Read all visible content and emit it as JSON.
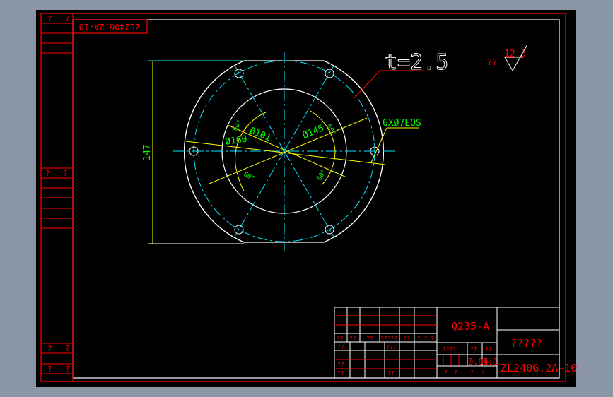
{
  "colors": {
    "background": "#000000",
    "frame": "#8a95a5",
    "border": "#ff0000",
    "geometry": "#ffffff",
    "centerline": "#00e5ff",
    "dimension": "#ffff00",
    "dimension_text": "#00ff00"
  },
  "drawing": {
    "thickness_note": "t=2.5",
    "roughness_prefix": "??",
    "roughness_value": "12.5",
    "hole_callout": "6XØ7EQS",
    "dim_height": "147",
    "dim_d160": "Ø160",
    "dim_d101": "Ø101",
    "dim_d145": "Ø145",
    "angle_labels": [
      "60°",
      "60°",
      "60°",
      "60°"
    ]
  },
  "left_strip": {
    "top_marks": [
      "?",
      "?"
    ],
    "mid_marks": [
      "?",
      "?"
    ],
    "bottom_marks_1": [
      "?",
      "?"
    ],
    "bottom_marks_2": [
      "?",
      "?"
    ]
  },
  "mirrored_code": "ZL240G.2A-10",
  "title_block": {
    "material": "Q235-A",
    "part_name": "?????",
    "drawing_number": "ZL240G.2A-10",
    "header_cells": [
      "??",
      "??",
      "??",
      "?????",
      "??",
      "?.?.?"
    ],
    "row_labels": [
      "??",
      "???",
      "??",
      "??",
      "??"
    ],
    "stage_label": "????",
    "weight_label": "??",
    "scale_label": "??",
    "weight": "0.94",
    "scale": "1:1",
    "sheet_marks": [
      "?",
      "?",
      "?",
      "?"
    ]
  }
}
